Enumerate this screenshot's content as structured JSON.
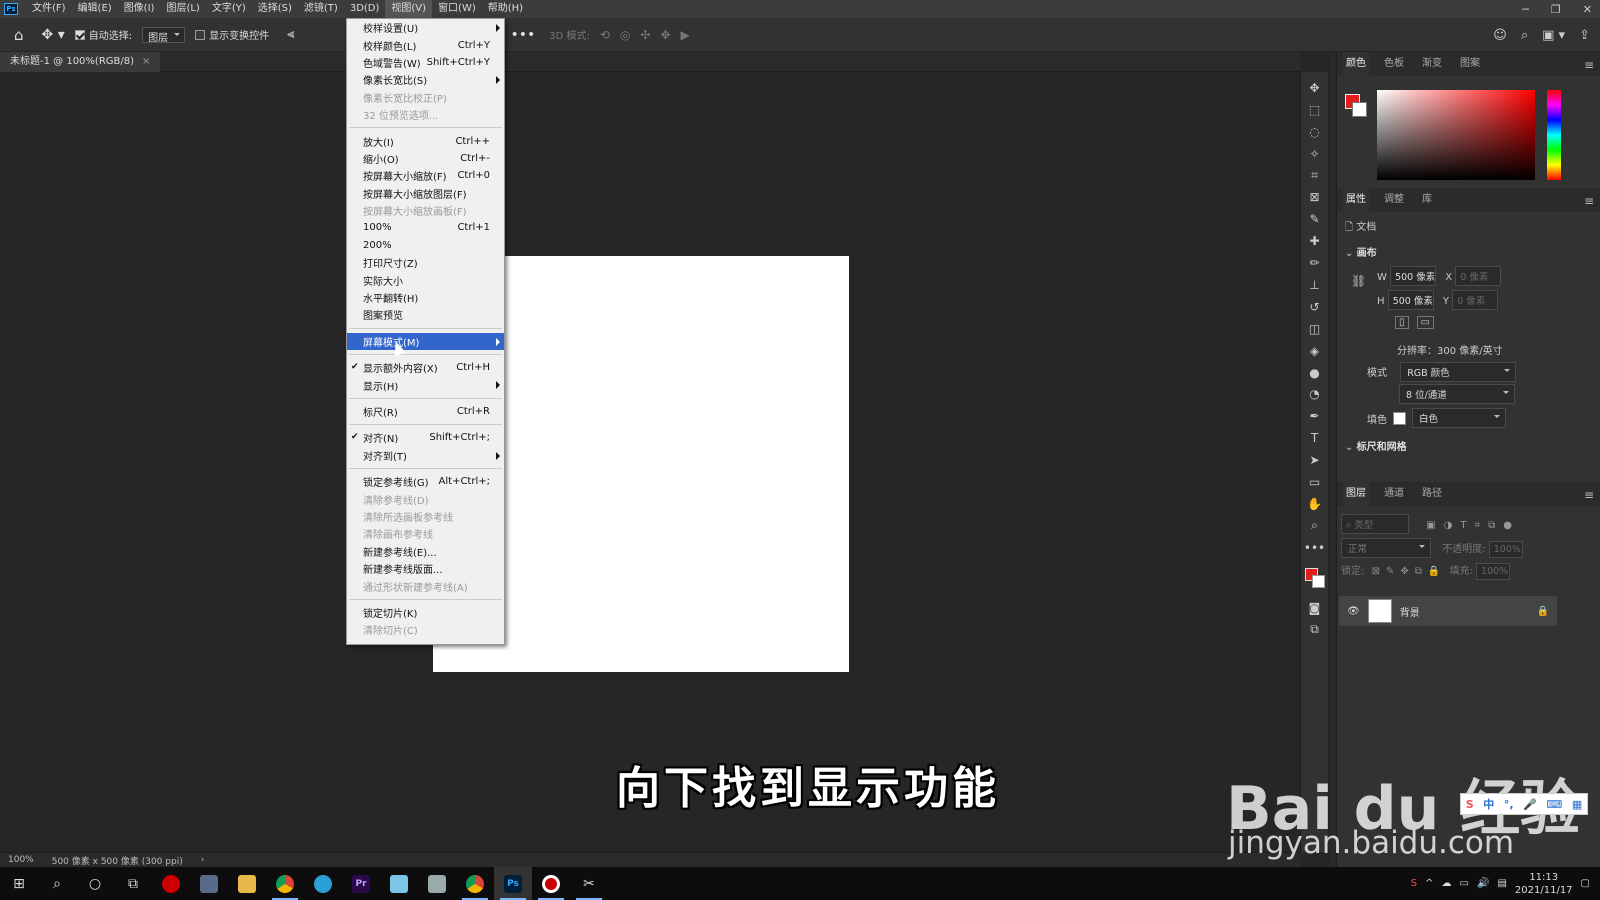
{
  "menubar": {
    "items": [
      "文件(F)",
      "编辑(E)",
      "图像(I)",
      "图层(L)",
      "文字(Y)",
      "选择(S)",
      "滤镜(T)",
      "3D(D)",
      "视图(V)",
      "窗口(W)",
      "帮助(H)"
    ],
    "active_index": 8
  },
  "options": {
    "auto_select_label": "自动选择:",
    "auto_select_value": "图层",
    "show_transform_label": "显示变换控件",
    "mode_3d_label": "3D 模式:"
  },
  "doc_tab": {
    "title": "未标题-1 @ 100%(RGB/8)"
  },
  "view_menu": {
    "items": [
      {
        "label": "校样设置(U)",
        "shortcut": "",
        "submenu": true
      },
      {
        "label": "校样颜色(L)",
        "shortcut": "Ctrl+Y"
      },
      {
        "label": "色域警告(W)",
        "shortcut": "Shift+Ctrl+Y"
      },
      {
        "label": "像素长宽比(S)",
        "shortcut": "",
        "submenu": true
      },
      {
        "label": "像素长宽比校正(P)",
        "shortcut": "",
        "disabled": true
      },
      {
        "label": "32 位预览选项...",
        "shortcut": "",
        "disabled": true
      },
      {
        "sep": true
      },
      {
        "label": "放大(I)",
        "shortcut": "Ctrl++"
      },
      {
        "label": "缩小(O)",
        "shortcut": "Ctrl+-"
      },
      {
        "label": "按屏幕大小缩放(F)",
        "shortcut": "Ctrl+0"
      },
      {
        "label": "按屏幕大小缩放图层(F)",
        "shortcut": ""
      },
      {
        "label": "按屏幕大小缩放画板(F)",
        "shortcut": "",
        "disabled": true
      },
      {
        "label": "100%",
        "shortcut": "Ctrl+1"
      },
      {
        "label": "200%",
        "shortcut": ""
      },
      {
        "label": "打印尺寸(Z)",
        "shortcut": ""
      },
      {
        "label": "实际大小",
        "shortcut": ""
      },
      {
        "label": "水平翻转(H)",
        "shortcut": ""
      },
      {
        "label": "图案预览",
        "shortcut": ""
      },
      {
        "sep": true
      },
      {
        "label": "屏幕模式(M)",
        "shortcut": "",
        "submenu": true,
        "highlight": true
      },
      {
        "sep": true
      },
      {
        "label": "显示额外内容(X)",
        "shortcut": "Ctrl+H",
        "checked": true
      },
      {
        "label": "显示(H)",
        "shortcut": "",
        "submenu": true
      },
      {
        "sep": true
      },
      {
        "label": "标尺(R)",
        "shortcut": "Ctrl+R"
      },
      {
        "sep": true
      },
      {
        "label": "对齐(N)",
        "shortcut": "Shift+Ctrl+;",
        "checked": true
      },
      {
        "label": "对齐到(T)",
        "shortcut": "",
        "submenu": true
      },
      {
        "sep": true
      },
      {
        "label": "锁定参考线(G)",
        "shortcut": "Alt+Ctrl+;"
      },
      {
        "label": "清除参考线(D)",
        "shortcut": "",
        "disabled": true
      },
      {
        "label": "清除所选画板参考线",
        "shortcut": "",
        "disabled": true
      },
      {
        "label": "清除画布参考线",
        "shortcut": "",
        "disabled": true
      },
      {
        "label": "新建参考线(E)...",
        "shortcut": ""
      },
      {
        "label": "新建参考线版面...",
        "shortcut": ""
      },
      {
        "label": "通过形状新建参考线(A)",
        "shortcut": "",
        "disabled": true
      },
      {
        "sep": true
      },
      {
        "label": "锁定切片(K)",
        "shortcut": ""
      },
      {
        "label": "清除切片(C)",
        "shortcut": "",
        "disabled": true
      }
    ]
  },
  "statusbar": {
    "zoom": "100%",
    "doc_size": "500 像素 x 500 像素 (300 ppi)"
  },
  "subtitle": "向下找到显示功能",
  "watermark": {
    "brand": "Bai du 经验",
    "url": "jingyan.baidu.com"
  },
  "color_panel": {
    "tabs": [
      "颜色",
      "色板",
      "渐变",
      "图案"
    ],
    "fg": "#e31c1c",
    "bg": "#ffffff"
  },
  "properties_panel": {
    "tabs": [
      "属性",
      "调整",
      "库"
    ],
    "doc_label": "文档",
    "canvas_title": "画布",
    "w_label": "W",
    "w_value": "500 像素",
    "h_label": "H",
    "h_value": "500 像素",
    "x_label": "X",
    "x_value": "0 像素",
    "y_label": "Y",
    "y_value": "0 像素",
    "resolution": "分辨率：300 像素/英寸",
    "mode_label": "模式",
    "mode_value": "RGB 颜色",
    "depth_value": "8 位/通道",
    "fill_label": "填色",
    "fill_value": "白色",
    "rulers_title": "标尺和网格"
  },
  "layers_panel": {
    "tabs": [
      "图层",
      "通道",
      "路径"
    ],
    "search_placeholder": "类型",
    "blend_mode": "正常",
    "opacity_label": "不透明度:",
    "opacity_value": "100%",
    "lock_label": "锁定:",
    "fill_label": "填充:",
    "fill_value": "100%",
    "layer_name": "背景"
  },
  "taskbar": {
    "time": "11:13",
    "date": "2021/11/17"
  }
}
